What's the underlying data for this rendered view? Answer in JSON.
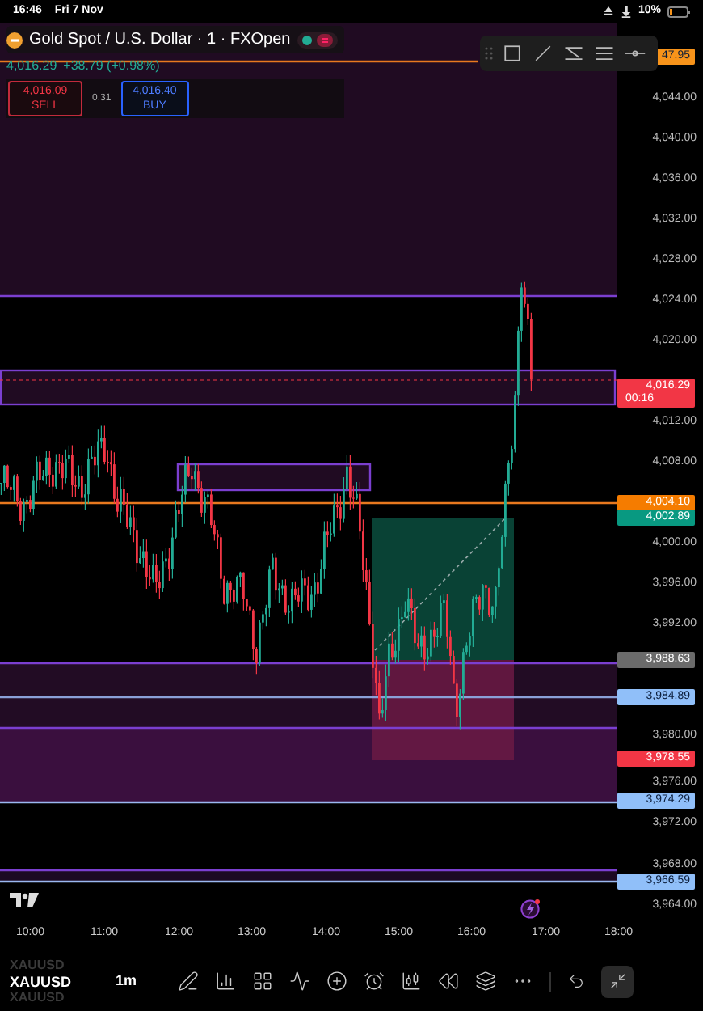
{
  "status_bar": {
    "time": "16:46",
    "date": "Fri 7 Nov",
    "battery": "10%"
  },
  "header": {
    "title": "Gold Spot / U.S. Dollar · 1 · FXOpen",
    "price": "4,016.29",
    "change": "+38.79 (+0.98%)",
    "sell": {
      "price": "4,016.09",
      "label": "SELL"
    },
    "spread": "0.31",
    "buy": {
      "price": "4,016.40",
      "label": "BUY"
    }
  },
  "price_axis": {
    "labels": [
      "4,044.00",
      "4,040.00",
      "4,036.00",
      "4,032.00",
      "4,028.00",
      "4,024.00",
      "4,020.00",
      "4,012.00",
      "4,008.00",
      "4,000.00",
      "3,996.00",
      "3,992.00",
      "3,980.00",
      "3,976.00",
      "3,972.00",
      "3,968.00",
      "3,964.00"
    ],
    "markers": [
      {
        "value": "47.95",
        "color": "#f7931a"
      },
      {
        "value": "4,016.29",
        "countdown": "00:16",
        "color": "#f23645"
      },
      {
        "value": "4,004.10",
        "color": "#f57c00"
      },
      {
        "value": "4,002.89",
        "color": "#089981"
      },
      {
        "value": "3,988.63",
        "color": "#6b6b6b"
      },
      {
        "value": "3,984.89",
        "color": "#90bff9"
      },
      {
        "value": "3,978.55",
        "color": "#f23645"
      },
      {
        "value": "3,974.29",
        "color": "#90bff9"
      },
      {
        "value": "3,966.59",
        "color": "#90bff9"
      }
    ]
  },
  "time_axis": {
    "labels": [
      "10:00",
      "11:00",
      "12:00",
      "13:00",
      "14:00",
      "15:00",
      "16:00",
      "17:00",
      "18:00"
    ]
  },
  "toolbar": {
    "symbols": [
      {
        "label": "XAUUSD",
        "selected": false
      },
      {
        "label": "XAUUSD",
        "selected": true
      },
      {
        "label": "XAUUSD",
        "selected": false
      }
    ],
    "interval": "1m"
  }
}
